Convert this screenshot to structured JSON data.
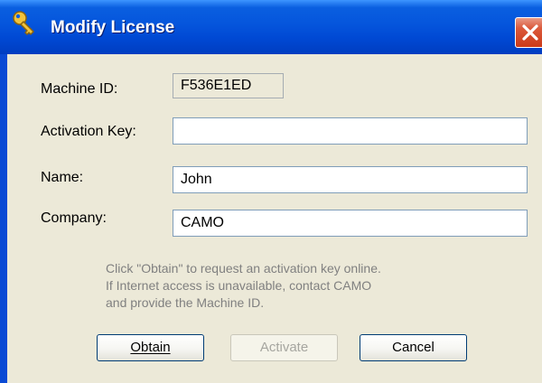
{
  "window": {
    "title": "Modify License",
    "title_icon": "key-icon",
    "close_icon": "close-icon"
  },
  "form": {
    "machine_id": {
      "label": "Machine ID:",
      "value": "F536E1ED"
    },
    "activation_key": {
      "label": "Activation Key:",
      "value": ""
    },
    "name": {
      "label": "Name:",
      "value": "John"
    },
    "company": {
      "label": "Company:",
      "value": "CAMO"
    }
  },
  "hint": {
    "line1": "Click \"Obtain\" to request an activation key online.",
    "line2": "If Internet access is unavailable, contact CAMO",
    "line3": "and provide the Machine ID."
  },
  "buttons": {
    "obtain": {
      "label": "Obtain",
      "underline": "O",
      "enabled": true
    },
    "activate": {
      "label": "Activate",
      "underline": "A",
      "enabled": false
    },
    "cancel": {
      "label": "Cancel",
      "enabled": true
    }
  },
  "colors": {
    "titlebar": "#0555dc",
    "dialog_bg": "#ece9d8",
    "close_button": "#db5a3c",
    "hint_text": "#808080"
  }
}
